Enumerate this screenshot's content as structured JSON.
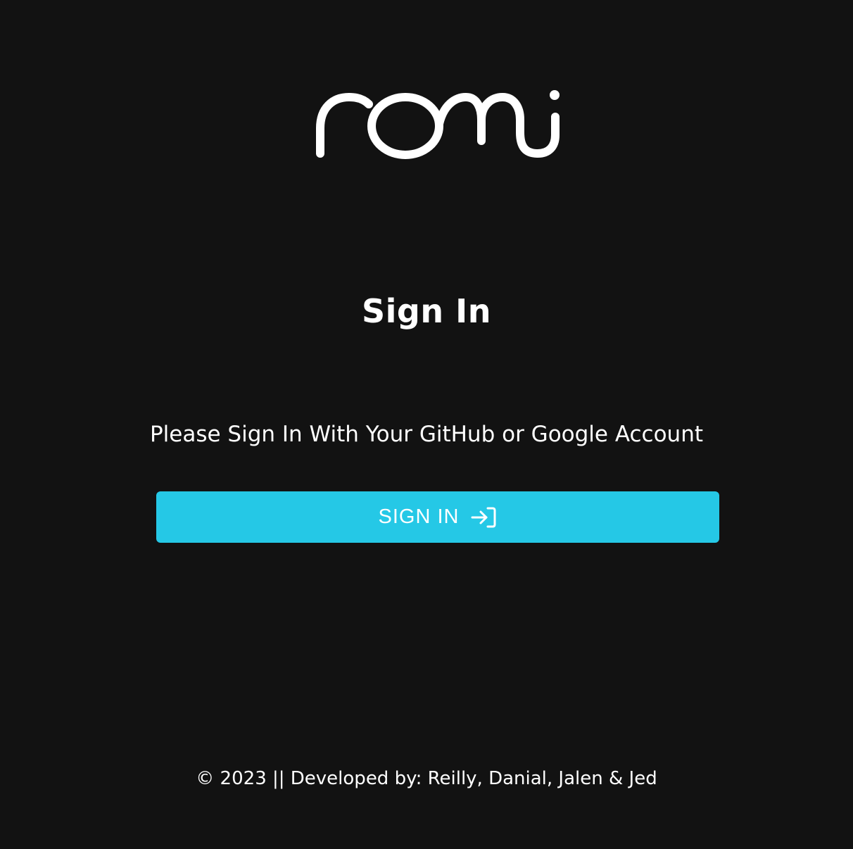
{
  "brand": {
    "logo_text": "romi"
  },
  "heading": "Sign In",
  "instructions": "Please Sign In With Your GitHub or Google Account",
  "signin_button": {
    "label": "SIGN IN",
    "icon": "login-icon",
    "background_color": "#25c8e6"
  },
  "footer": {
    "text": "© 2023 || Developed by: Reilly, Danial, Jalen & Jed"
  },
  "colors": {
    "page_background": "#121212",
    "text": "#ffffff"
  }
}
